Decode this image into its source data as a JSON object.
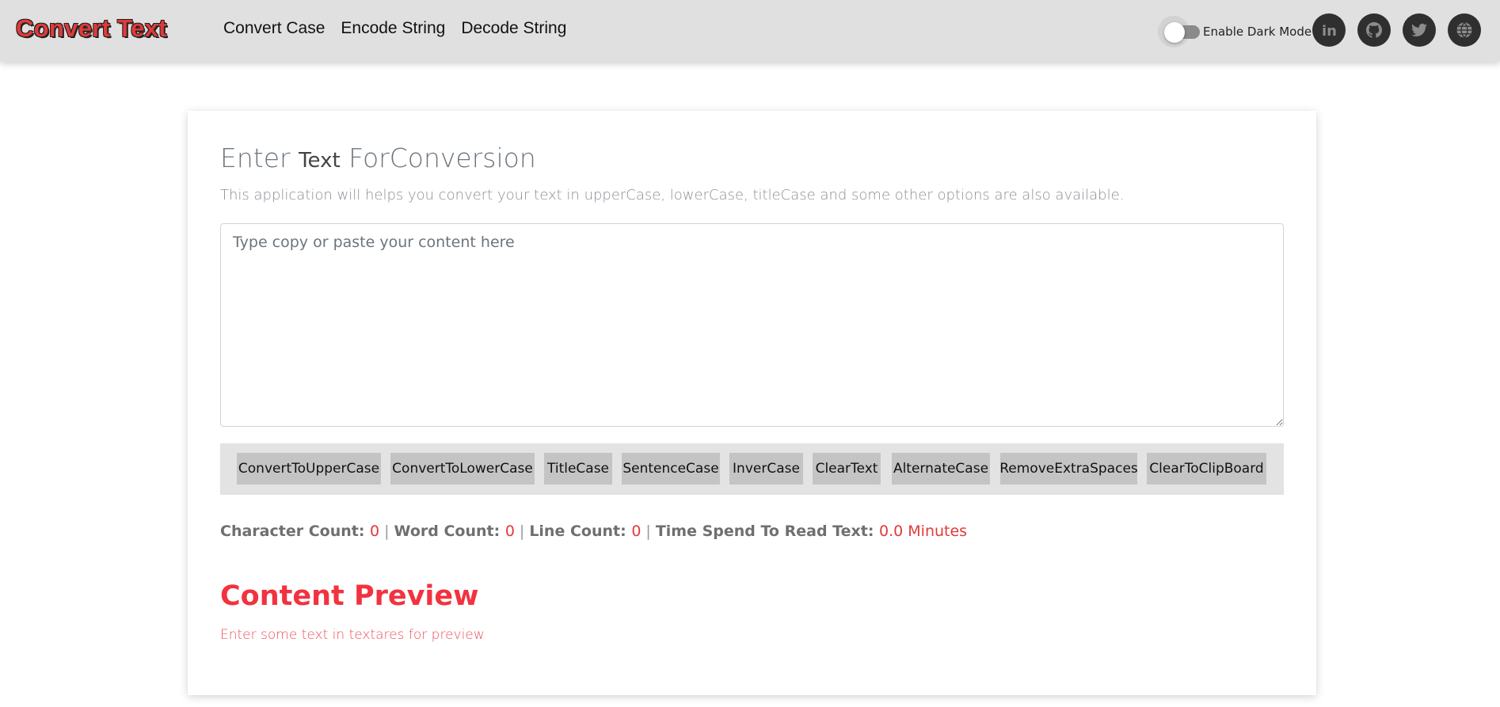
{
  "brand": "Convert Text",
  "nav": {
    "links": [
      "Convert Case",
      "Encode String",
      "Decode String"
    ]
  },
  "dark_mode": {
    "label": "Enable Dark Mode",
    "enabled": false
  },
  "social_icons": [
    "linkedin-icon",
    "github-icon",
    "twitter-icon",
    "globe-icon"
  ],
  "card": {
    "title_part1": "Enter ",
    "title_part2": "Text",
    "title_part3": " ForConversion",
    "subtitle": "This application will helps you convert your text in upperCase, lowerCase, titleCase and some other options are also available.",
    "textarea_placeholder": "Type copy or paste your content here",
    "textarea_value": ""
  },
  "buttons": [
    "ConvertToUpperCase",
    "ConvertToLowerCase",
    "TitleCase",
    "SentenceCase",
    "InverCase",
    "ClearText",
    "AlternateCase",
    "RemoveExtraSpaces",
    "ClearToClipBoard"
  ],
  "stats": {
    "char_label": "Character Count: ",
    "char_value": "0",
    "word_label": "Word Count: ",
    "word_value": "0",
    "line_label": "Line Count: ",
    "line_value": "0",
    "time_label": "Time Spend To Read Text: ",
    "time_value": "0.0 Minutes"
  },
  "preview": {
    "title": "Content Preview",
    "text": "Enter some text in textares for preview"
  },
  "colors": {
    "brand": "#e03a3a",
    "navbar_bg": "#e0e0e0",
    "accent_red": "#f2323f",
    "button_bg": "#c4c4c4"
  }
}
